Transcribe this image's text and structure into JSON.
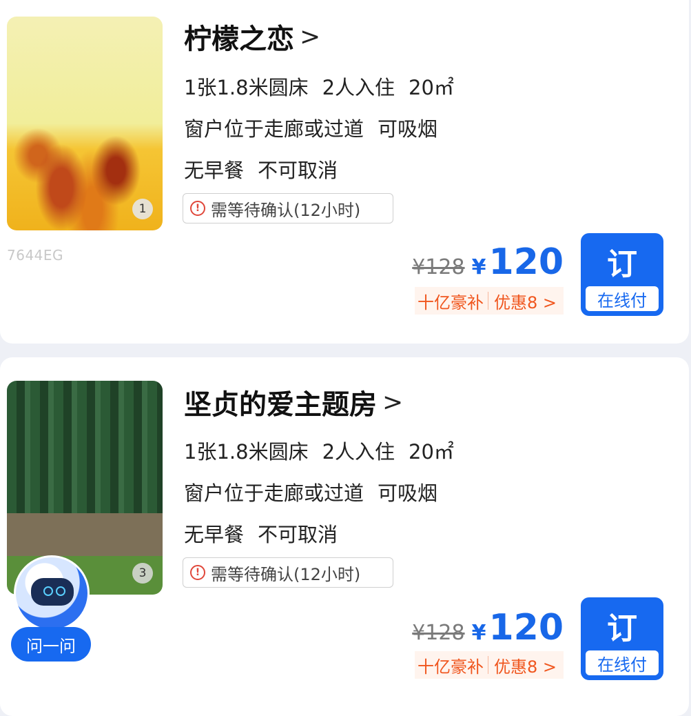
{
  "rooms": [
    {
      "name": "柠檬之恋",
      "chevron": ">",
      "photo_count": "1",
      "room_code": "7644EG",
      "bed": "1张1.8米圆床",
      "guests": "2人入住",
      "area": "20㎡",
      "window": "窗户位于走廊或过道",
      "smoking": "可吸烟",
      "breakfast": "无早餐",
      "cancel": "不可取消",
      "confirm_icon": "!",
      "confirm_note": "需等待确认(12小时)",
      "original_price": "¥128",
      "currency": "¥",
      "price": "120",
      "subsidy": "十亿豪补",
      "discount": "优惠8 >",
      "book_label": "订",
      "pay_label": "在线付"
    },
    {
      "name": "坚贞的爱主题房",
      "chevron": ">",
      "photo_count": "3",
      "room_code": "",
      "bed": "1张1.8米圆床",
      "guests": "2人入住",
      "area": "20㎡",
      "window": "窗户位于走廊或过道",
      "smoking": "可吸烟",
      "breakfast": "无早餐",
      "cancel": "不可取消",
      "confirm_icon": "!",
      "confirm_note": "需等待确认(12小时)",
      "original_price": "¥128",
      "currency": "¥",
      "price": "120",
      "subsidy": "十亿豪补",
      "discount": "优惠8 >",
      "book_label": "订",
      "pay_label": "在线付"
    }
  ],
  "assistant": {
    "label": "问一问"
  },
  "colors": {
    "accent_blue": "#1769f0",
    "promo_orange": "#f0561e",
    "warning_red": "#e0473a"
  }
}
